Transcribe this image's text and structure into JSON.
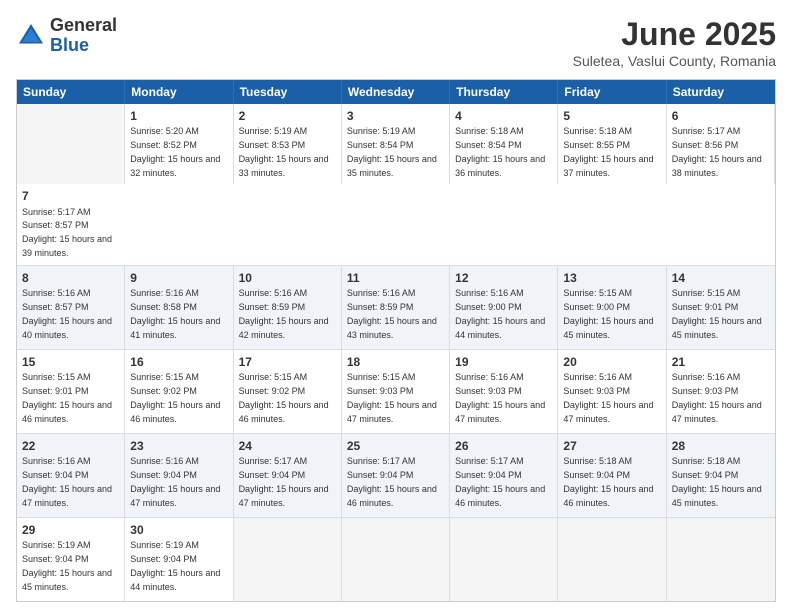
{
  "logo": {
    "general": "General",
    "blue": "Blue"
  },
  "title": "June 2025",
  "location": "Suletea, Vaslui County, Romania",
  "days": [
    "Sunday",
    "Monday",
    "Tuesday",
    "Wednesday",
    "Thursday",
    "Friday",
    "Saturday"
  ],
  "rows": [
    [
      {
        "day": "",
        "empty": true
      },
      {
        "day": "1",
        "rise": "5:20 AM",
        "set": "8:52 PM",
        "daylight": "15 hours and 32 minutes."
      },
      {
        "day": "2",
        "rise": "5:19 AM",
        "set": "8:53 PM",
        "daylight": "15 hours and 33 minutes."
      },
      {
        "day": "3",
        "rise": "5:19 AM",
        "set": "8:54 PM",
        "daylight": "15 hours and 35 minutes."
      },
      {
        "day": "4",
        "rise": "5:18 AM",
        "set": "8:54 PM",
        "daylight": "15 hours and 36 minutes."
      },
      {
        "day": "5",
        "rise": "5:18 AM",
        "set": "8:55 PM",
        "daylight": "15 hours and 37 minutes."
      },
      {
        "day": "6",
        "rise": "5:17 AM",
        "set": "8:56 PM",
        "daylight": "15 hours and 38 minutes."
      },
      {
        "day": "7",
        "rise": "5:17 AM",
        "set": "8:57 PM",
        "daylight": "15 hours and 39 minutes."
      }
    ],
    [
      {
        "day": "8",
        "rise": "5:16 AM",
        "set": "8:57 PM",
        "daylight": "15 hours and 40 minutes."
      },
      {
        "day": "9",
        "rise": "5:16 AM",
        "set": "8:58 PM",
        "daylight": "15 hours and 41 minutes."
      },
      {
        "day": "10",
        "rise": "5:16 AM",
        "set": "8:59 PM",
        "daylight": "15 hours and 42 minutes."
      },
      {
        "day": "11",
        "rise": "5:16 AM",
        "set": "8:59 PM",
        "daylight": "15 hours and 43 minutes."
      },
      {
        "day": "12",
        "rise": "5:16 AM",
        "set": "9:00 PM",
        "daylight": "15 hours and 44 minutes."
      },
      {
        "day": "13",
        "rise": "5:15 AM",
        "set": "9:00 PM",
        "daylight": "15 hours and 45 minutes."
      },
      {
        "day": "14",
        "rise": "5:15 AM",
        "set": "9:01 PM",
        "daylight": "15 hours and 45 minutes."
      }
    ],
    [
      {
        "day": "15",
        "rise": "5:15 AM",
        "set": "9:01 PM",
        "daylight": "15 hours and 46 minutes."
      },
      {
        "day": "16",
        "rise": "5:15 AM",
        "set": "9:02 PM",
        "daylight": "15 hours and 46 minutes."
      },
      {
        "day": "17",
        "rise": "5:15 AM",
        "set": "9:02 PM",
        "daylight": "15 hours and 46 minutes."
      },
      {
        "day": "18",
        "rise": "5:15 AM",
        "set": "9:03 PM",
        "daylight": "15 hours and 47 minutes."
      },
      {
        "day": "19",
        "rise": "5:16 AM",
        "set": "9:03 PM",
        "daylight": "15 hours and 47 minutes."
      },
      {
        "day": "20",
        "rise": "5:16 AM",
        "set": "9:03 PM",
        "daylight": "15 hours and 47 minutes."
      },
      {
        "day": "21",
        "rise": "5:16 AM",
        "set": "9:03 PM",
        "daylight": "15 hours and 47 minutes."
      }
    ],
    [
      {
        "day": "22",
        "rise": "5:16 AM",
        "set": "9:04 PM",
        "daylight": "15 hours and 47 minutes."
      },
      {
        "day": "23",
        "rise": "5:16 AM",
        "set": "9:04 PM",
        "daylight": "15 hours and 47 minutes."
      },
      {
        "day": "24",
        "rise": "5:17 AM",
        "set": "9:04 PM",
        "daylight": "15 hours and 47 minutes."
      },
      {
        "day": "25",
        "rise": "5:17 AM",
        "set": "9:04 PM",
        "daylight": "15 hours and 46 minutes."
      },
      {
        "day": "26",
        "rise": "5:17 AM",
        "set": "9:04 PM",
        "daylight": "15 hours and 46 minutes."
      },
      {
        "day": "27",
        "rise": "5:18 AM",
        "set": "9:04 PM",
        "daylight": "15 hours and 46 minutes."
      },
      {
        "day": "28",
        "rise": "5:18 AM",
        "set": "9:04 PM",
        "daylight": "15 hours and 45 minutes."
      }
    ],
    [
      {
        "day": "29",
        "rise": "5:19 AM",
        "set": "9:04 PM",
        "daylight": "15 hours and 45 minutes."
      },
      {
        "day": "30",
        "rise": "5:19 AM",
        "set": "9:04 PM",
        "daylight": "15 hours and 44 minutes."
      },
      {
        "day": "",
        "empty": true
      },
      {
        "day": "",
        "empty": true
      },
      {
        "day": "",
        "empty": true
      },
      {
        "day": "",
        "empty": true
      },
      {
        "day": "",
        "empty": true
      }
    ]
  ]
}
